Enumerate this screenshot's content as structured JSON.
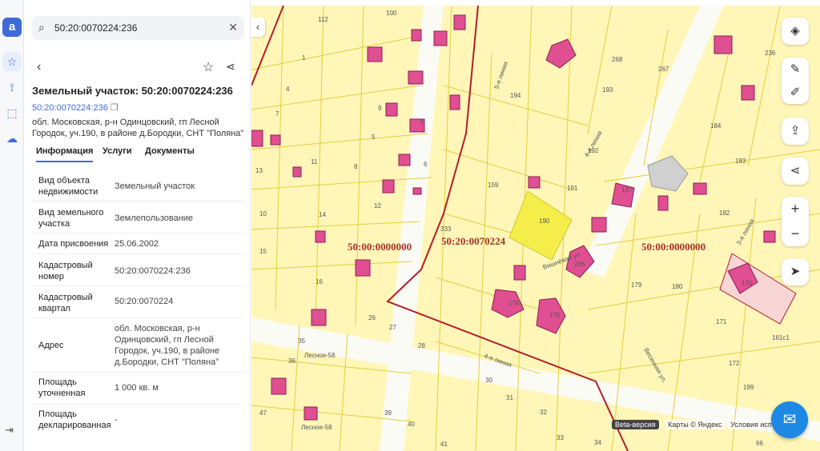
{
  "sidebar": {
    "logo": "a"
  },
  "panel": {
    "search_value": "50:20:0070224:236",
    "title": "Земельный участок: 50:20:0070224:236",
    "cad_link": "50:20:0070224:236",
    "address_line": "обл. Московская, р-н Одинцовский, гп Лесной Городок, уч.190, в районе д.Бородки, СНТ \"Поляна\"",
    "tabs": [
      "Информация",
      "Услуги",
      "Документы"
    ],
    "rows": [
      {
        "label": "Вид объекта недвижимости",
        "value": "Земельный участок"
      },
      {
        "label": "Вид земельного участка",
        "value": "Землепользование"
      },
      {
        "label": "Дата присвоения",
        "value": "25.06.2002"
      },
      {
        "label": "Кадастровый номер",
        "value": "50:20:0070224:236"
      },
      {
        "label": "Кадастровый квартал",
        "value": "50:20:0070224"
      },
      {
        "label": "Адрес",
        "value": "обл. Московская, р-н Одинцовский, гп Лесной Городок, уч.190, в районе д.Бородки, СНТ \"Поляна\""
      },
      {
        "label": "Площадь уточненная",
        "value": "1 000 кв. м"
      },
      {
        "label": "Площадь декларированная",
        "value": "-"
      }
    ]
  },
  "map": {
    "quarter_labels": [
      "50:00:0000000",
      "50:20:0070224",
      "50:00:0000000"
    ],
    "street_labels": [
      "5-я линия",
      "4-я линия",
      "3-я линия",
      "4-я линия",
      "Лесное-58",
      "Лесное-58",
      "Вишнёвая ул.",
      "Весенняя ул."
    ],
    "parcel_numbers": [
      "112",
      "100",
      "1",
      "4",
      "7",
      "9",
      "5",
      "3",
      "6",
      "8",
      "11",
      "13",
      "14",
      "12",
      "10",
      "15",
      "16",
      "194",
      "268",
      "267",
      "236",
      "193",
      "184",
      "192",
      "183",
      "159",
      "191",
      "187",
      "190",
      "333",
      "182",
      "236",
      "179",
      "180",
      "170",
      "176",
      "175",
      "171",
      "161с1",
      "26",
      "27",
      "28",
      "35",
      "36",
      "30",
      "31",
      "32",
      "33",
      "34",
      "39",
      "40",
      "41",
      "47",
      "66",
      "172",
      "199"
    ],
    "footer": {
      "beta": "Beta-версия",
      "maps": "Карты © Яндекс",
      "terms": "Условия испол"
    },
    "colors": {
      "parcel_fill": "#fff6b8",
      "parcel_line": "#e2cf3d",
      "quarter_border": "#b01e2c",
      "building": "#e04f91",
      "selected": "#f5ee4a",
      "accent": "#3f6bd8"
    }
  }
}
